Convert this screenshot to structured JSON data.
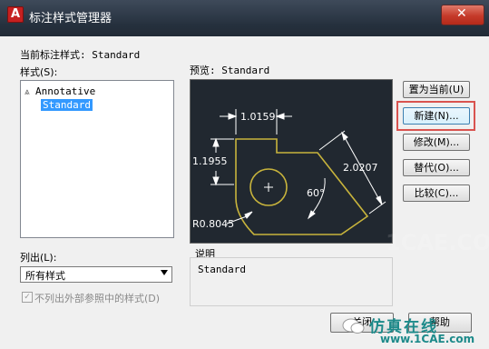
{
  "window": {
    "title": "标注样式管理器",
    "close_label": "✕"
  },
  "current_style": {
    "label": "当前标注样式: Standard"
  },
  "styles_list": {
    "label": "样式(S):",
    "items": [
      {
        "name": "Annotative",
        "icon": "annotative-icon",
        "selected": false
      },
      {
        "name": "Standard",
        "icon": "",
        "selected": true
      }
    ]
  },
  "preview": {
    "label": "预览: Standard",
    "dims": {
      "top": "1.0159",
      "left": "1.1955",
      "diag": "2.0207",
      "angle": "60°",
      "radius": "R0.8045"
    },
    "watermark": "1CAE.COM"
  },
  "list_filter": {
    "label": "列出(L):",
    "value": "所有样式"
  },
  "exclude_xref": {
    "label": "不列出外部参照中的样式(D)",
    "checked": true
  },
  "description": {
    "label": "说明",
    "text": "Standard"
  },
  "buttons": {
    "set_current": "置为当前(U)",
    "new": "新建(N)...",
    "modify": "修改(M)...",
    "override": "替代(O)...",
    "compare": "比较(C)..."
  },
  "bottom": {
    "close": "关闭",
    "help": "帮助"
  },
  "watermark": {
    "brand": "仿真在线",
    "url": "www.1CAE.com"
  },
  "colors": {
    "accent_highlight": "#d9534f",
    "selection": "#3399ff",
    "preview_bg": "#212830",
    "geometry": "#c8b43c"
  }
}
